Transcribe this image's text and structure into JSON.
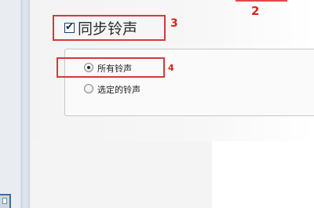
{
  "annotations": {
    "step_2": "2",
    "step_3": "3",
    "step_4": "4"
  },
  "sync": {
    "label": "同步铃声",
    "checked": true
  },
  "ringtone_options": {
    "all_label": "所有铃声",
    "selected_label": "选定的铃声",
    "selected_option": "所有铃声"
  },
  "colors": {
    "annotation_red": "#d43a3a",
    "panel_bg": "#fafafa"
  }
}
